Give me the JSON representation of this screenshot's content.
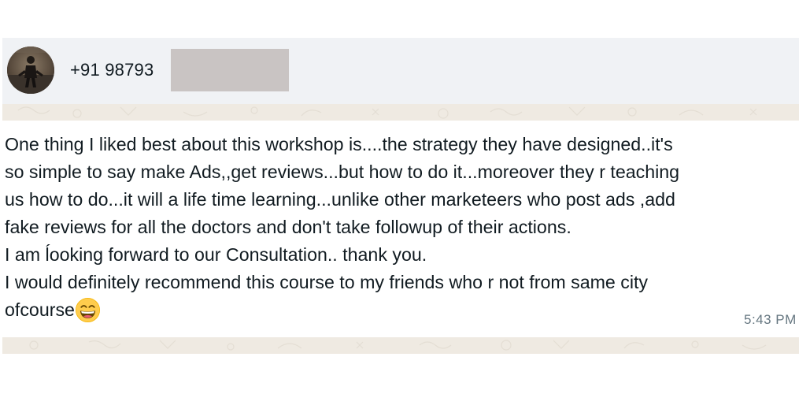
{
  "header": {
    "contact_number": "+91 98793",
    "avatar_icon": "contact-photo-icon",
    "redaction_color": "#c9c4c3"
  },
  "message": {
    "lines": [
      "One thing I liked best about this workshop is....the strategy they have designed..it's",
      "so simple to say make Ads,,get reviews...but how to do it...moreover they r teaching",
      "us how to do...it will a life time learning...unlike other marketeers who post ads ,add",
      "fake reviews for all the doctors and don't take followup of their actions.",
      "I am ĺooking forward to our Consultation.. thank you.",
      "I would definitely recommend this course to my friends who r not from same city",
      "ofcourse"
    ],
    "emoji": "grinning-face-with-smiling-eyes-emoji",
    "timestamp": "5:43 PM"
  },
  "colors": {
    "header_bg": "#f0f2f5",
    "wallpaper_bg": "#efeae2",
    "bubble_bg": "#ffffff",
    "text": "#111b21",
    "timestamp": "#667781"
  }
}
